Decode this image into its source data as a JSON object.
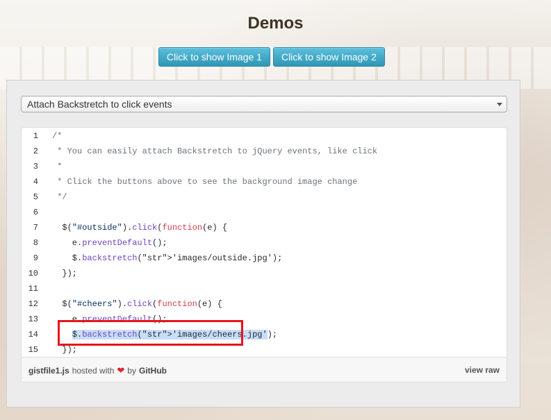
{
  "page": {
    "title": "Demos"
  },
  "buttons": [
    {
      "label": "Click to show Image 1"
    },
    {
      "label": "Click to show Image 2"
    }
  ],
  "select": {
    "value": "Attach Backstretch to click events"
  },
  "code_lines": [
    {
      "n": "1",
      "text": "/*"
    },
    {
      "n": "2",
      "text": " * You can easily attach Backstretch to jQuery events, like click"
    },
    {
      "n": "3",
      "text": " *"
    },
    {
      "n": "4",
      "text": " * Click the buttons above to see the background image change"
    },
    {
      "n": "5",
      "text": " */"
    },
    {
      "n": "6",
      "text": ""
    },
    {
      "n": "7",
      "text": "  $(\"#outside\").click(function(e) {"
    },
    {
      "n": "8",
      "text": "    e.preventDefault();"
    },
    {
      "n": "9",
      "text": "    $.backstretch('images/outside.jpg');"
    },
    {
      "n": "10",
      "text": "  });"
    },
    {
      "n": "11",
      "text": ""
    },
    {
      "n": "12",
      "text": "  $(\"#cheers\").click(function(e) {"
    },
    {
      "n": "13",
      "text": "    e.preventDefault();"
    },
    {
      "n": "14",
      "text": "    $.backstretch('images/cheers.jpg');"
    },
    {
      "n": "15",
      "text": "  });"
    }
  ],
  "highlighted_line": "14",
  "gist_footer": {
    "filename": "gistfile1.js",
    "hosted_with": "hosted with",
    "by": "by",
    "github": "GitHub",
    "view_raw": "view raw"
  },
  "colors": {
    "button": "#31b0d5",
    "highlight_box": "#e8131b"
  }
}
